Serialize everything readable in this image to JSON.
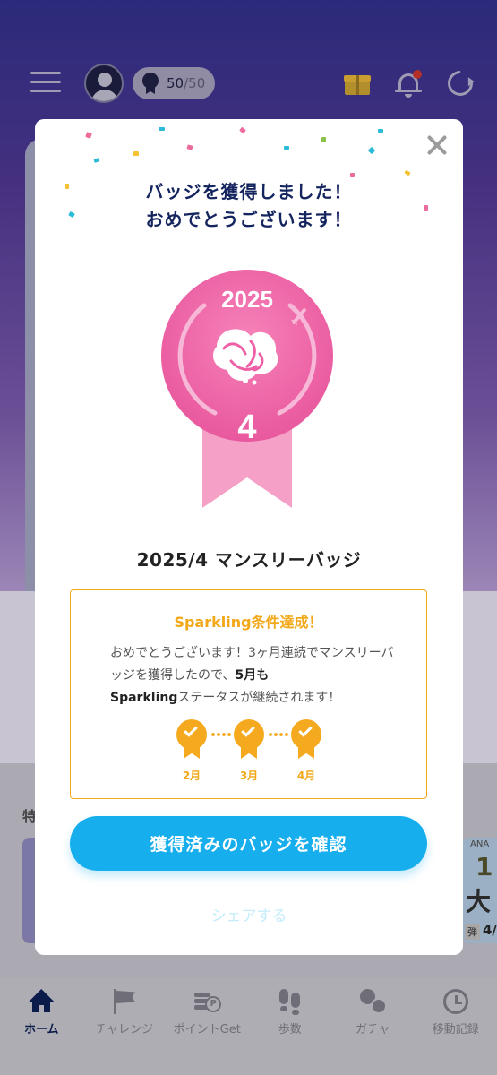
{
  "topbar": {
    "badge_count": "50",
    "badge_total": "/50"
  },
  "background": {
    "section_label": "特",
    "banner": {
      "brand": "ANA",
      "big1": "1",
      "big2": "大",
      "tag": "弾",
      "date": "4/"
    }
  },
  "modal": {
    "title_line1": "バッジを獲得しました！",
    "title_line2": "おめでとうございます！",
    "medal": {
      "year": "2025",
      "month": "4",
      "icon": "cherry-blossom-icon",
      "secondary_icon": "airplane-icon"
    },
    "badge_name": "2025/4 マンスリーバッジ",
    "info": {
      "title": "Sparkling条件達成！",
      "text_part1": "おめでとうございます！3ヶ月連続でマンスリーバッジを獲得したので、",
      "text_bold1": "5月も",
      "text_bold2": "Sparkling",
      "text_part2": "ステータスが継続されます！",
      "months": [
        "2月",
        "3月",
        "4月"
      ]
    },
    "cta_label": "獲得済みのバッジを確認",
    "share_label": "シェアする"
  },
  "bottom_nav": [
    {
      "label": "ホーム",
      "icon": "home-icon",
      "active": true
    },
    {
      "label": "チャレンジ",
      "icon": "flag-icon",
      "active": false
    },
    {
      "label": "ポイントGet",
      "icon": "points-icon",
      "active": false
    },
    {
      "label": "歩数",
      "icon": "footsteps-icon",
      "active": false
    },
    {
      "label": "ガチャ",
      "icon": "gacha-icon",
      "active": false
    },
    {
      "label": "移動記録",
      "icon": "clock-icon",
      "active": false
    }
  ],
  "colors": {
    "accent_blue": "#16aeec",
    "title_navy": "#14245e",
    "sparkling_orange": "#f2a818",
    "medal_pink": "#ee5fa6"
  }
}
